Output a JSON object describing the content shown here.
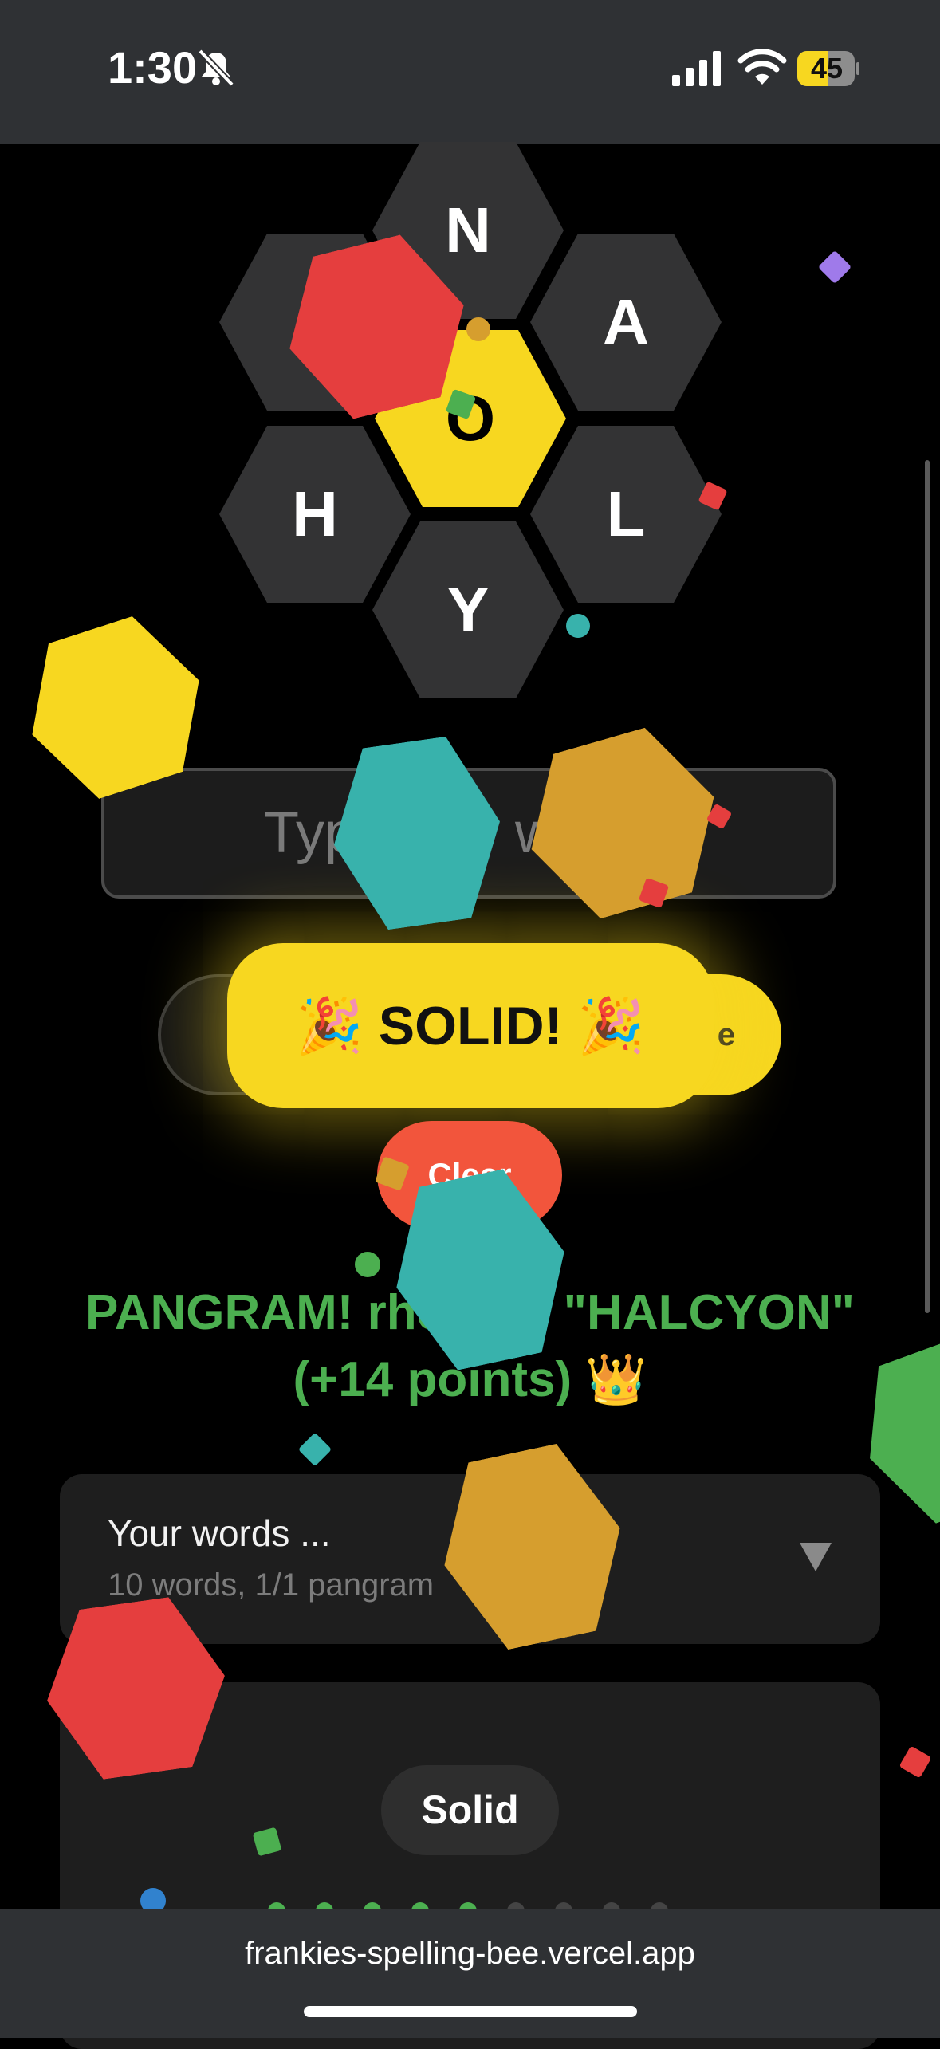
{
  "status_bar": {
    "time": "1:30",
    "battery": "45",
    "icons": [
      "bell-slash-icon",
      "signal-icon",
      "wifi-icon",
      "battery-icon"
    ]
  },
  "hive": {
    "letters": {
      "top": "N",
      "top_left": "",
      "top_right": "A",
      "center": "O",
      "bottom_left": "H",
      "bottom_right": "L",
      "bottom": "Y"
    },
    "colors": {
      "outer": "#333334",
      "center": "#f7d720"
    }
  },
  "input": {
    "placeholder_visible": "Typ",
    "placeholder_tail": "w"
  },
  "toast": {
    "text": "🎉 SOLID! 🎉"
  },
  "buttons": {
    "enter_tail": "e",
    "clear": "Clear"
  },
  "message": {
    "line1_a": "PANGRAM! rhea",
    "line1_b": "d \"HALCYON\"",
    "line2": "(+14 points) 👑"
  },
  "words_panel": {
    "title": "Your words ...",
    "subtitle": "10 words, 1/1 pangram"
  },
  "rank": {
    "label": "Solid",
    "progress_filled": 5,
    "progress_total": 9
  },
  "browser": {
    "url": "frankies-spelling-bee.vercel.app"
  },
  "colors": {
    "yellow": "#f7d720",
    "teal": "#38b2ac",
    "orange": "#d69e2e",
    "red": "#e53e3e",
    "green": "#4caf50",
    "purple": "#9f7aea",
    "blue": "#3182ce"
  }
}
